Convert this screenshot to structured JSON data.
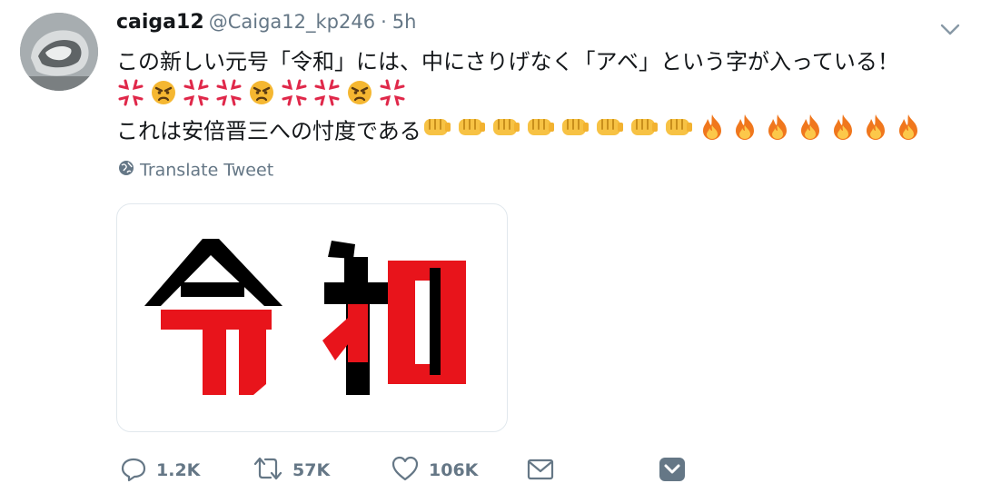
{
  "tweet": {
    "display_name": "caiga12",
    "handle": "@Caiga12_kp246",
    "separator": "·",
    "time": "5h",
    "line1": "この新しい元号「令和」には、中にさりげなく「アベ」という字が入っている！",
    "line3_text": "これは安倍晋三への忖度である",
    "line2_emojis": [
      "anger-symbol",
      "angry-face",
      "anger-symbol",
      "anger-symbol",
      "angry-face",
      "anger-symbol",
      "anger-symbol",
      "angry-face",
      "anger-symbol"
    ],
    "line3_emojis": [
      "fist",
      "fist",
      "fist",
      "fist",
      "fist",
      "fist",
      "fist",
      "fist",
      "fire",
      "fire",
      "fire",
      "fire",
      "fire",
      "fire",
      "fire"
    ],
    "translate_label": "Translate Tweet"
  },
  "media": {
    "image_text_char1": "令",
    "image_text_char2": "和"
  },
  "actions": {
    "reply_count": "1.2K",
    "retweet_count": "57K",
    "like_count": "106K"
  },
  "colors": {
    "secondary_text": "#657786",
    "highlight_red": "#e8141b",
    "text": "#14171a"
  }
}
